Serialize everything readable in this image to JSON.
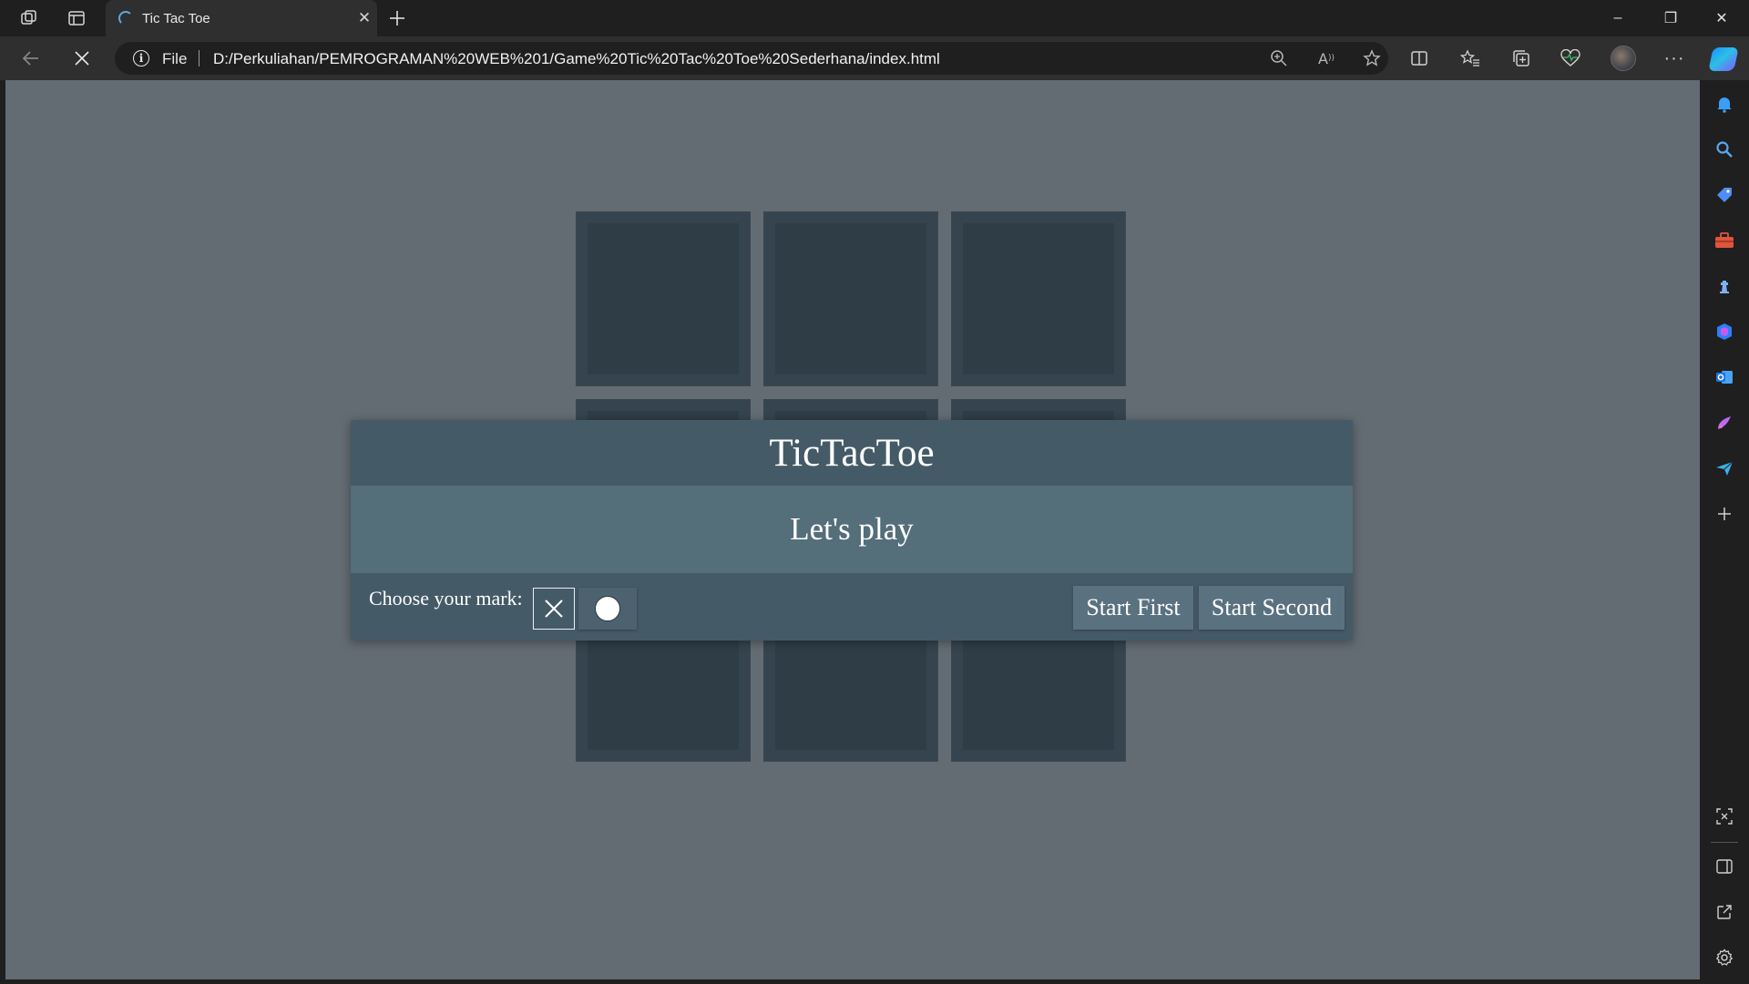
{
  "browser": {
    "tab_title": "Tic Tac Toe",
    "address": {
      "scheme_label": "File",
      "url": "D:/Perkuliahan/PEMROGRAMAN%20WEB%201/Game%20Tic%20Tac%20Toe%20Sederhana/index.html"
    },
    "icons": {
      "workspaces": "workspaces-icon",
      "tab_actions": "tab-actions-icon",
      "new_tab": "plus-icon",
      "back": "arrow-left-icon",
      "stop": "close-icon",
      "site_info": "info-icon",
      "zoom": "zoom-icon",
      "read_aloud": "read-aloud-icon",
      "favorite": "star-icon",
      "split_screen": "split-screen-icon",
      "favorites": "favorites-icon",
      "collections": "collections-icon",
      "browser_essentials": "heart-pulse-icon",
      "more": "ellipsis-icon",
      "copilot": "copilot-icon"
    },
    "window_controls": {
      "minimize": "–",
      "restore": "❐",
      "close": "✕"
    }
  },
  "sidebar": {
    "icons": [
      "bell-icon",
      "search-icon",
      "tag-icon",
      "toolbox-icon",
      "chess-icon",
      "microsoft-365-icon",
      "outlook-icon",
      "designer-icon",
      "send-icon",
      "add-icon",
      "screenshot-icon",
      "sidebar-toggle-icon",
      "external-link-icon",
      "gear-icon"
    ],
    "colors": {
      "bell": "#3a9ff5",
      "search": "#58a6f0",
      "tag": "#4f8df5",
      "toolbox": "#e0543c",
      "chess": "#7fb2f0",
      "m365": "#2d7ff9",
      "outlook": "#1a73e8",
      "designer": "#b86bf0",
      "send": "#39b2e8"
    }
  },
  "game": {
    "board_cells": [
      "",
      "",
      "",
      "",
      "",
      "",
      "",
      "",
      ""
    ],
    "dialog": {
      "title": "TicTacToe",
      "message": "Let's play",
      "choose_label": "Choose your mark:",
      "mark_x": "✕",
      "start_first": "Start First",
      "start_second": "Start Second"
    },
    "colors": {
      "page_bg": "#636b73",
      "cell": "#35444e",
      "header": "#455a67",
      "body": "#546e7a",
      "button": "#5a7180"
    }
  }
}
